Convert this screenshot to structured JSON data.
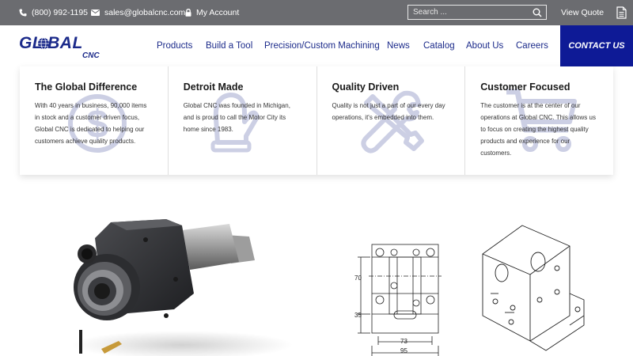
{
  "topbar": {
    "phone": "(800) 992-1195",
    "email": "sales@globalcnc.com",
    "account": "My Account",
    "search_placeholder": "Search ...",
    "quote": "View Quote"
  },
  "logo": {
    "main": "GL BAL",
    "sub": "CNC"
  },
  "nav": {
    "items": [
      "Products",
      "Build a Tool",
      "Precision/Custom Machining",
      "News",
      "Catalog",
      "About Us",
      "Careers"
    ],
    "contact": "CONTACT US"
  },
  "features": [
    {
      "title": "The Global Difference",
      "text": "With 40 years in business, 90,000 items in stock and a customer driven focus, Global CNC is dedicated to helping our customers achieve quality products.",
      "icon": "dollar-icon"
    },
    {
      "title": "Detroit Made",
      "text": "Global CNC was founded in Michigan, and is proud to call the Motor City its home since 1983.",
      "icon": "mitten-icon"
    },
    {
      "title": "Quality Driven",
      "text": "Quality is not just a part of our every day operations, it's embedded into them.",
      "icon": "tools-icon"
    },
    {
      "title": "Customer Focused",
      "text": "The customer is at the center of our operations at Global CNC. This allows us to focus on creating the highest quality products and experience for our customers.",
      "icon": "cart-icon"
    }
  ],
  "drawing": {
    "dim_70": "70",
    "dim_35": "35",
    "dim_73": "73",
    "dim_95": "95"
  },
  "colors": {
    "topbar": "#6b6c70",
    "brand_blue": "#1b2a8a",
    "contact_bg": "#0e1a96"
  }
}
